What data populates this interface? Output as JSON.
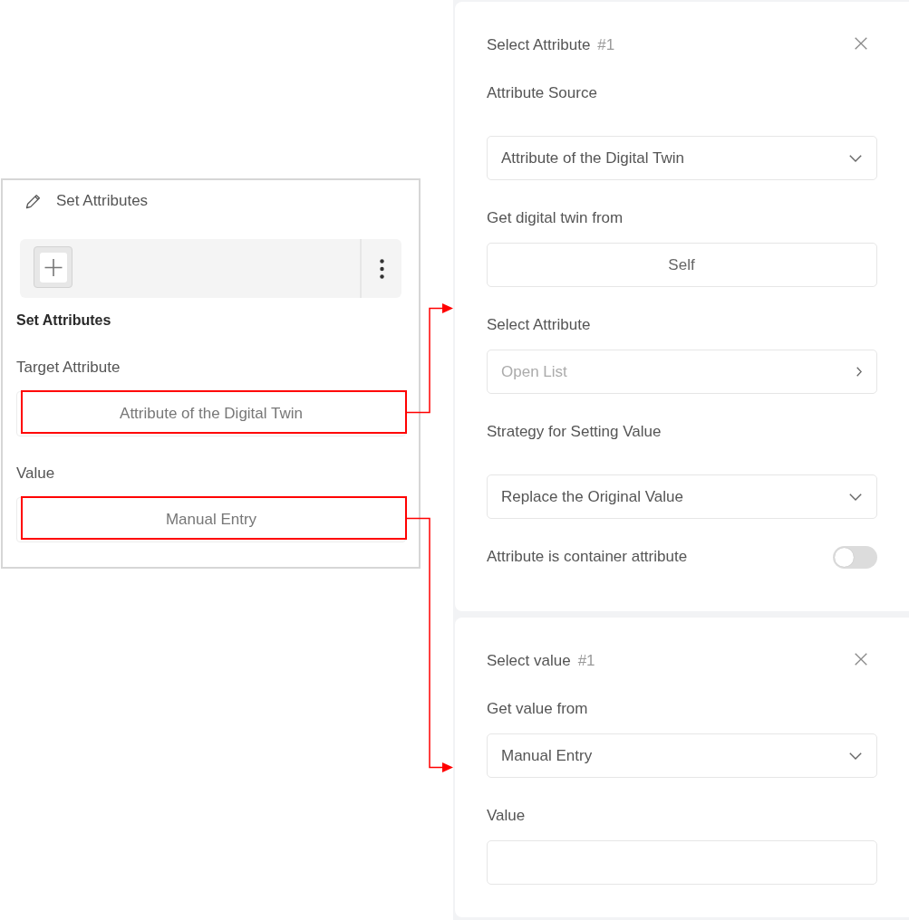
{
  "left_card": {
    "title": "Set Attributes",
    "section_title": "Set Attributes",
    "fields": [
      {
        "label": "Target Attribute",
        "value": "Attribute of the Digital Twin",
        "highlighted": true
      },
      {
        "label": "Value",
        "value": "Manual Entry",
        "highlighted": true
      }
    ]
  },
  "panels": [
    {
      "title": "Select Attribute",
      "number": "#1",
      "fields": [
        {
          "kind": "dropdown",
          "label": "Attribute Source",
          "value": "Attribute of the Digital Twin"
        },
        {
          "kind": "picker",
          "label": "Get digital twin from",
          "value": "Self"
        },
        {
          "kind": "list",
          "label": "Select Attribute",
          "placeholder": "Open List"
        },
        {
          "kind": "dropdown",
          "label": "Strategy for Setting Value",
          "value": "Replace the Original Value"
        },
        {
          "kind": "toggle",
          "label": "Attribute is container attribute",
          "on": false
        }
      ]
    },
    {
      "title": "Select value",
      "number": "#1",
      "fields": [
        {
          "kind": "dropdown",
          "label": "Get value from",
          "value": "Manual Entry"
        },
        {
          "kind": "input",
          "label": "Value"
        }
      ]
    }
  ]
}
